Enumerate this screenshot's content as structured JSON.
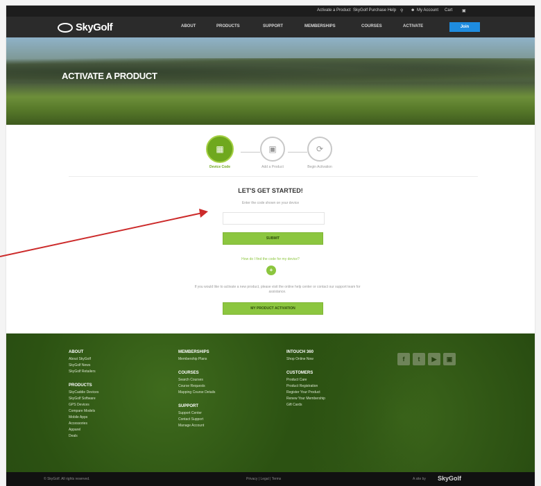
{
  "utility_bar": {
    "links": [
      "Activate a Product",
      "SkyGolf Purchase Help",
      "My Account",
      "Cart"
    ],
    "search_icon": "search-icon",
    "user_icon": "user-icon",
    "cart_icon": "cart-icon"
  },
  "nav": {
    "logo": "SkyGolf",
    "items": [
      "About",
      "Products",
      "Support",
      "Memberships",
      "Courses",
      "Activate",
      "Join"
    ]
  },
  "hero": {
    "title": "ACTIVATE A PRODUCT"
  },
  "steps": [
    {
      "label": "Device Code",
      "active": true,
      "icon": "device-icon"
    },
    {
      "label": "Add a Product",
      "active": false,
      "icon": "product-icon"
    },
    {
      "label": "Begin Activation",
      "active": false,
      "icon": "refresh-icon"
    }
  ],
  "main": {
    "heading": "LET'S GET STARTED!",
    "subtext": "Enter the code shown on your device",
    "input_placeholder": "",
    "submit_label": "SUBMIT",
    "help_link": "How do I find the code for my device?",
    "info_text": "If you would like to activate a new product, please visit the online help center or contact our support team for assistance.",
    "secondary_button_label": "MY PRODUCT ACTIVATION"
  },
  "footer": {
    "columns": [
      {
        "sections": [
          {
            "title": "ABOUT",
            "items": [
              "About SkyGolf",
              "SkyGolf News",
              "SkyGolf Retailers"
            ]
          },
          {
            "title": "PRODUCTS",
            "items": [
              "SkyCaddie Devices",
              "SkyGolf Software",
              "GPS Devices",
              "Compare Models",
              "Mobile Apps",
              "Accessories",
              "Apparel",
              "Deals"
            ]
          }
        ]
      },
      {
        "sections": [
          {
            "title": "MEMBERSHIPS",
            "items": [
              "Membership Plans"
            ]
          },
          {
            "title": "COURSES",
            "items": [
              "Search Courses",
              "Course Requests",
              "Mapping Course Details"
            ]
          },
          {
            "title": "SUPPORT",
            "items": [
              "Support Center",
              "Contact Support",
              "Manage Account"
            ]
          }
        ]
      },
      {
        "sections": [
          {
            "title": "INTOUCH 360",
            "items": [
              "Shop Online Now"
            ]
          },
          {
            "title": "CUSTOMERS",
            "items": [
              "Product Care",
              "Product Registration",
              "Register Your Product",
              "Renew Your Membership",
              "Gift Cards"
            ]
          }
        ]
      }
    ],
    "social": [
      "facebook-icon",
      "twitter-icon",
      "youtube-icon",
      "instagram-icon"
    ]
  },
  "bottom_bar": {
    "copyright": "© SkyGolf. All rights reserved.",
    "links": "Privacy  |  Legal  |  Terms",
    "powered": "A site by",
    "logo": "SkyGolf"
  },
  "annotation": {
    "color": "#cc2a2a"
  }
}
